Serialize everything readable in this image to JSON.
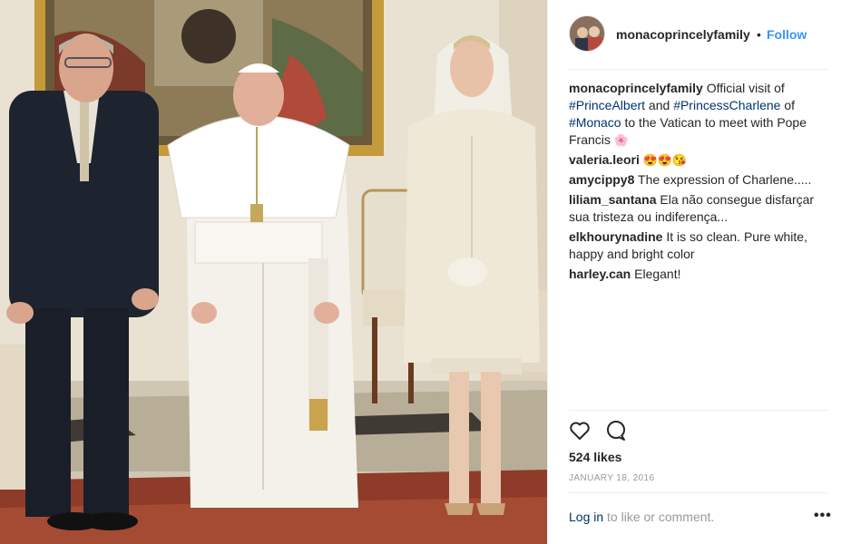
{
  "post": {
    "username": "monacoprincelyfamily",
    "follow_label": "Follow",
    "separator": "•",
    "caption": {
      "username": "monacoprincelyfamily",
      "text_1": " Official visit of ",
      "tag_1": "#PrinceAlbert",
      "text_2": " and ",
      "tag_2": "#PrincessCharlene",
      "text_3": " of ",
      "tag_3": "#Monaco",
      "text_4": " to the Vatican to meet with Pope Francis ",
      "emoji": "🌸"
    },
    "comments": [
      {
        "username": "valeria.leori",
        "text": " 😍😍😘"
      },
      {
        "username": "amycippy8",
        "text": " The expression of Charlene....."
      },
      {
        "username": "liliam_santana",
        "text": " Ela não consegue disfarçar sua tristeza ou indiferença..."
      },
      {
        "username": "elkhourynadine",
        "text": " It is so clean. Pure white, happy and bright color"
      },
      {
        "username": "harley.can",
        "text": " Elegant!"
      }
    ],
    "likes": "524 likes",
    "date": "January 18, 2016",
    "login_link": "Log in",
    "login_text": " to like or comment.",
    "more_label": "•••",
    "icons": {
      "like": "heart-outline-icon",
      "comment": "speech-bubble-icon",
      "more": "ellipsis-icon"
    }
  }
}
